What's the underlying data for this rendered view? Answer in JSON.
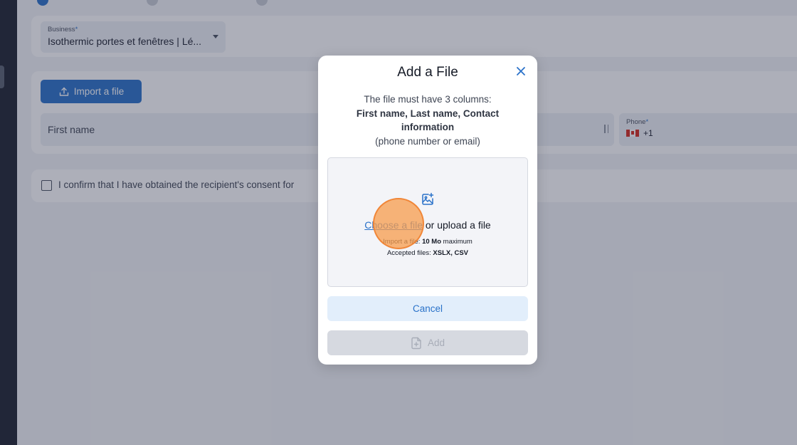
{
  "business": {
    "label": "Business",
    "required_mark": "*",
    "value": "Isothermic portes et fenêtres | Lé..."
  },
  "recipients": {
    "import_button_label": "Import a file",
    "first_name_placeholder": "First name",
    "phone_label": "Phone",
    "phone_required_mark": "*",
    "phone_prefix": "+1",
    "phone_country": "Canada"
  },
  "consent": {
    "text": "I confirm that I have obtained the recipient's consent for"
  },
  "modal": {
    "title": "Add a File",
    "desc_line1": "The file must have 3 columns:",
    "desc_line2": "First name, Last name, Contact information",
    "desc_line3": "(phone number or email)",
    "choose_link": "Choose a file",
    "upload_text": " or upload a file",
    "import_prefix": "Import a file: ",
    "import_size": "10 Mo",
    "import_suffix": " maximum",
    "accepted_prefix": "Accepted files: ",
    "accepted_types": "XSLX, CSV",
    "cancel_label": "Cancel",
    "add_label": "Add"
  },
  "colors": {
    "accent": "#2a72c9",
    "sidebar": "#1e2230",
    "click_highlight": "#f79c4c"
  },
  "icons": {
    "close": "close-icon",
    "upload": "upload-icon",
    "image_add": "image-add-icon",
    "file_add": "file-add-icon"
  }
}
